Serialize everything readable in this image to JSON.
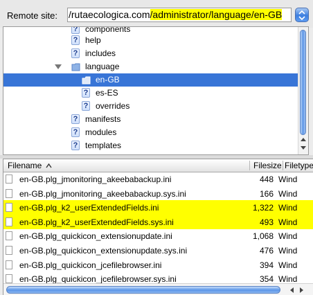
{
  "remote_site": {
    "label": "Remote site:",
    "path_prefix": "/rutaecologica.com",
    "path_highlight": "/administrator/language/en-GB"
  },
  "tree": {
    "items": [
      {
        "label": "components",
        "icon": "question-icon",
        "depth": 2
      },
      {
        "label": "help",
        "icon": "question-icon",
        "depth": 2
      },
      {
        "label": "includes",
        "icon": "question-icon",
        "depth": 2
      },
      {
        "label": "language",
        "icon": "folder-icon",
        "depth": 2,
        "expanded": true
      },
      {
        "label": "en-GB",
        "icon": "folder-icon",
        "depth": 3,
        "selected": true
      },
      {
        "label": "es-ES",
        "icon": "question-icon",
        "depth": 3
      },
      {
        "label": "overrides",
        "icon": "question-icon",
        "depth": 3
      },
      {
        "label": "manifests",
        "icon": "question-icon",
        "depth": 2
      },
      {
        "label": "modules",
        "icon": "question-icon",
        "depth": 2
      },
      {
        "label": "templates",
        "icon": "question-icon",
        "depth": 2
      }
    ]
  },
  "file_list": {
    "columns": {
      "filename": "Filename",
      "filesize": "Filesize",
      "filetype": "Filetype"
    },
    "sort_indicator": "sort-ascending-icon",
    "rows": [
      {
        "name": "en-GB.plg_jmonitoring_akeebabackup.ini",
        "size": "448",
        "type": "Wind",
        "highlight": false
      },
      {
        "name": "en-GB.plg_jmonitoring_akeebabackup.sys.ini",
        "size": "166",
        "type": "Wind",
        "highlight": false
      },
      {
        "name": "en-GB.plg_k2_userExtendedFields.ini",
        "size": "1,322",
        "type": "Wind",
        "highlight": true
      },
      {
        "name": "en-GB.plg_k2_userExtendedFields.sys.ini",
        "size": "493",
        "type": "Wind",
        "highlight": true
      },
      {
        "name": "en-GB.plg_quickicon_extensionupdate.ini",
        "size": "1,068",
        "type": "Wind",
        "highlight": false
      },
      {
        "name": "en-GB.plg_quickicon_extensionupdate.sys.ini",
        "size": "476",
        "type": "Wind",
        "highlight": false
      },
      {
        "name": "en-GB.plg_quickicon_jcefilebrowser.ini",
        "size": "394",
        "type": "Wind",
        "highlight": false
      },
      {
        "name": "en-GB.plg_quickicon_jcefilebrowser.sys.ini",
        "size": "354",
        "type": "Wind",
        "highlight": false
      }
    ]
  },
  "colors": {
    "highlight": "#ffff00",
    "selection": "#3875d7",
    "accent": "#3d7fe0"
  }
}
